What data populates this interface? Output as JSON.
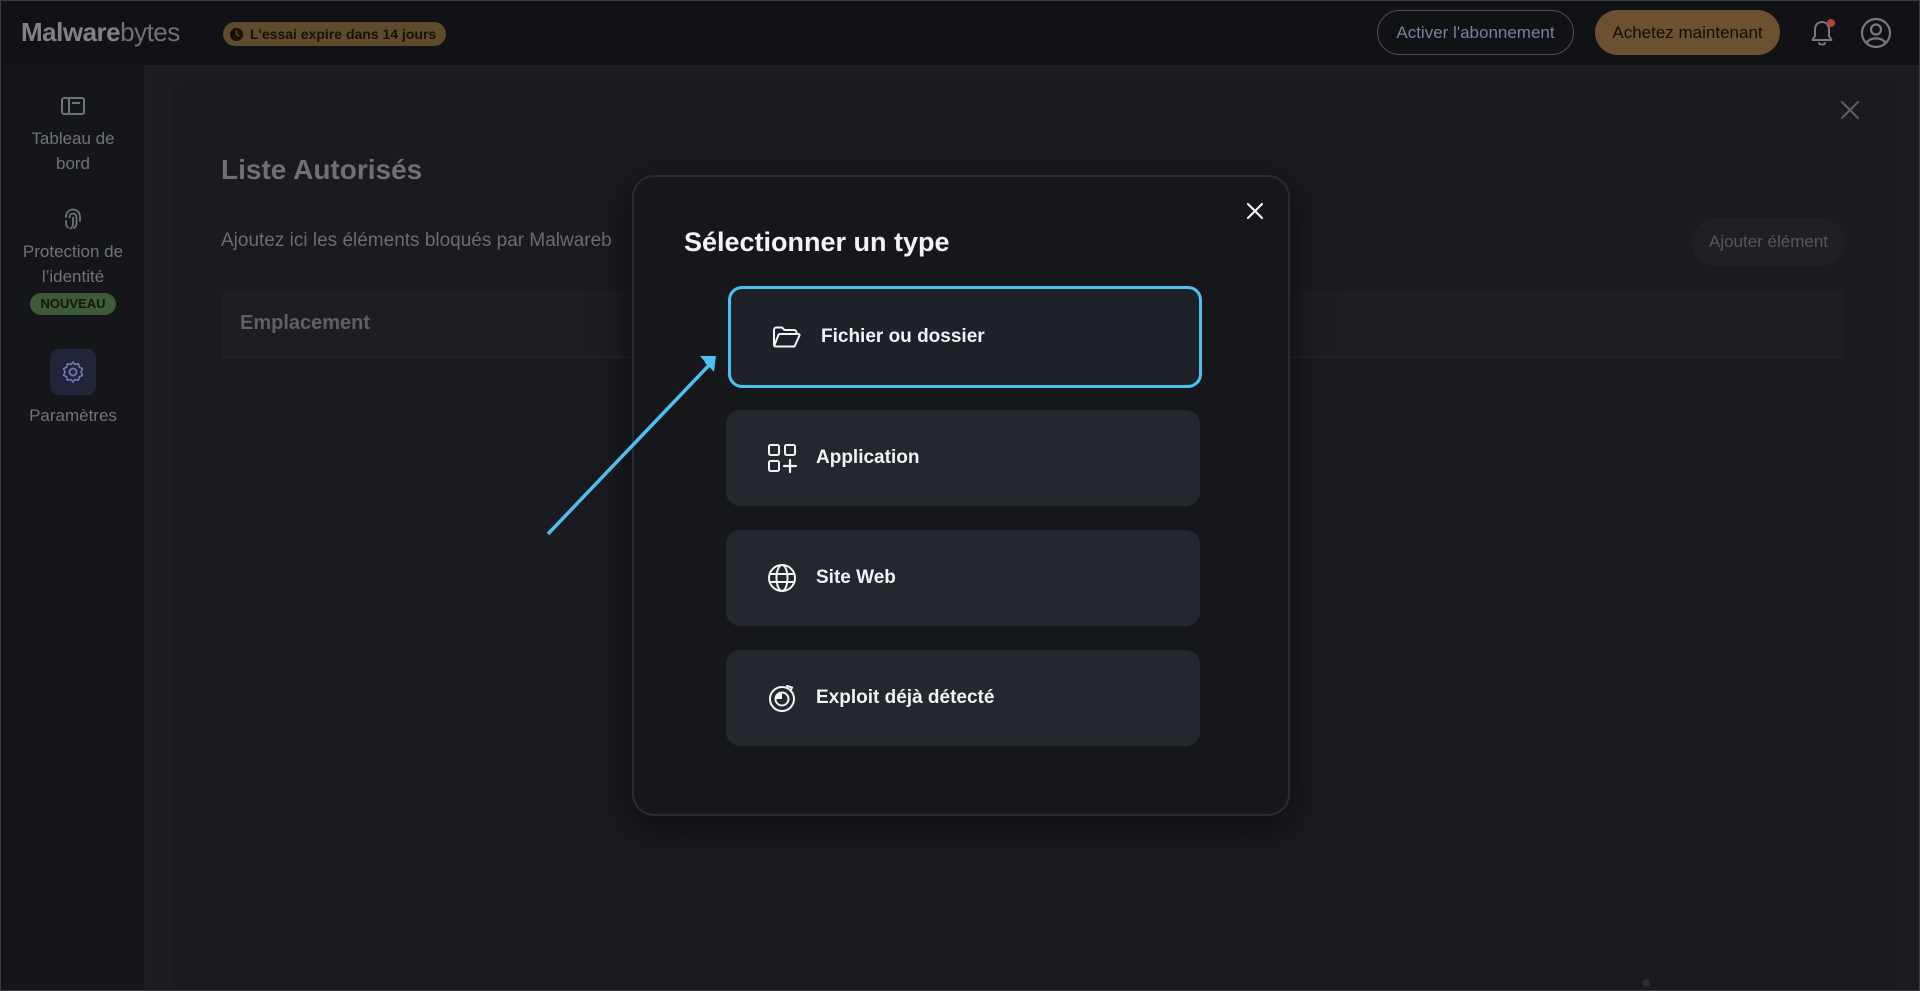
{
  "header": {
    "logo_bold": "Malware",
    "logo_light": "bytes",
    "trial_badge": "L'essai expire dans 14 jours",
    "activate_button": "Activer l'abonnement",
    "buy_button": "Achetez maintenant",
    "notification_icon": "bell-icon",
    "account_icon": "user-circle-icon"
  },
  "sidebar": {
    "items": [
      {
        "label": "Tableau de bord",
        "icon": "dashboard-icon"
      },
      {
        "label": "Protection de l’identité",
        "icon": "fingerprint-icon",
        "badge": "NOUVEAU"
      },
      {
        "label": "Paramètres",
        "icon": "gear-icon"
      }
    ]
  },
  "panel": {
    "title": "Liste Autorisés",
    "description": "Ajoutez ici les éléments bloqués par Malwareb",
    "add_button": "Ajouter élément",
    "columns": [
      "Emplacement"
    ]
  },
  "modal": {
    "title": "Sélectionner un type",
    "options": [
      {
        "label": "Fichier ou dossier",
        "icon": "folder-open-icon",
        "selected": true
      },
      {
        "label": "Application",
        "icon": "app-grid-plus-icon",
        "selected": false
      },
      {
        "label": "Site Web",
        "icon": "globe-icon",
        "selected": false
      },
      {
        "label": "Exploit déjà détecté",
        "icon": "exploit-target-icon",
        "selected": false
      }
    ]
  },
  "colors": {
    "accent_highlight": "#4cc0f0",
    "buy_button": "#6b5130",
    "trial_badge": "#5e4a2c",
    "new_badge": "#3d5a3a",
    "modal_background": "#16171b",
    "option_background": "#25272e"
  }
}
